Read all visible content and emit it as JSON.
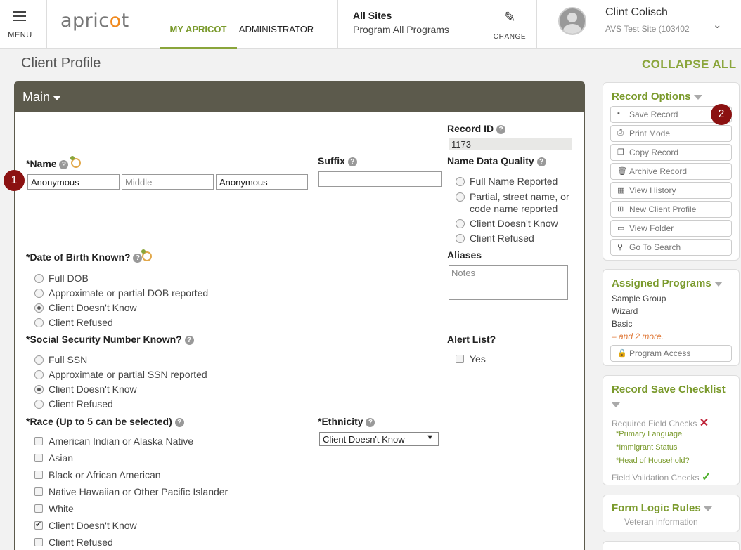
{
  "topbar": {
    "menu_label": "MENU",
    "logo_pre": "apric",
    "logo_dot": "o",
    "logo_post": "t",
    "tabs": [
      {
        "label": "MY APRICOT",
        "active": true
      },
      {
        "label": "ADMINISTRATOR",
        "active": false
      }
    ],
    "site_title": "All Sites",
    "site_program": "Program All Programs",
    "change_label": "CHANGE",
    "user_name": "Clint Colisch",
    "user_site": "AVS Test Site (103402"
  },
  "page": {
    "title": "Client Profile",
    "collapse_all": "COLLAPSE ALL"
  },
  "main": {
    "section_title": "Main",
    "record_id_label": "Record ID",
    "record_id_value": "1173",
    "name_label": "*Name",
    "name_first": "Anonymous",
    "name_middle_placeholder": "Middle",
    "name_last": "Anonymous",
    "suffix_label": "Suffix",
    "suffix_value": "",
    "name_quality_label": "Name Data Quality",
    "name_quality_options": [
      {
        "label": "Full Name Reported",
        "selected": false
      },
      {
        "label": "Partial, street name, or",
        "selected": false
      },
      {
        "label": "code name reported",
        "selected": false
      },
      {
        "label": "Client Doesn't Know",
        "selected": false
      },
      {
        "label": "Client Refused",
        "selected": false
      }
    ],
    "dob_label": "*Date of Birth Known?",
    "dob_options": [
      {
        "label": "Full DOB",
        "selected": false
      },
      {
        "label": "Approximate or partial DOB reported",
        "selected": false
      },
      {
        "label": "Client Doesn't Know",
        "selected": true
      },
      {
        "label": "Client Refused",
        "selected": false
      }
    ],
    "aliases_label": "Aliases",
    "aliases_placeholder": "Notes",
    "ssn_label": "*Social Security Number Known?",
    "ssn_options": [
      {
        "label": "Full SSN",
        "selected": false
      },
      {
        "label": "Approximate or partial SSN reported",
        "selected": false
      },
      {
        "label": "Client Doesn't Know",
        "selected": true
      },
      {
        "label": "Client Refused",
        "selected": false
      }
    ],
    "alert_label": "Alert List?",
    "alert_option": "Yes",
    "race_label": "*Race (Up to 5 can be selected)",
    "race_options": [
      {
        "label": "American Indian or Alaska Native",
        "checked": false
      },
      {
        "label": "Asian",
        "checked": false
      },
      {
        "label": "Black or African American",
        "checked": false
      },
      {
        "label": "Native Hawaiian or Other Pacific Islander",
        "checked": false
      },
      {
        "label": "White",
        "checked": false
      },
      {
        "label": "Client Doesn't Know",
        "checked": true
      },
      {
        "label": "Client Refused",
        "checked": false
      }
    ],
    "ethnicity_label": "*Ethnicity",
    "ethnicity_value": "Client Doesn't Know",
    "badge_1": "1",
    "badge_2": "2"
  },
  "record_options": {
    "title": "Record Options",
    "buttons": [
      {
        "label": "Save Record",
        "icon": "save-icon",
        "glyph": "▪"
      },
      {
        "label": "Print Mode",
        "icon": "print-icon",
        "glyph": "⎙"
      },
      {
        "label": "Copy Record",
        "icon": "copy-icon",
        "glyph": "❐"
      },
      {
        "label": "Archive Record",
        "icon": "trash-icon",
        "glyph": "🗑"
      },
      {
        "label": "View History",
        "icon": "calendar-icon",
        "glyph": "▦"
      },
      {
        "label": "New Client Profile",
        "icon": "new-document-icon",
        "glyph": "⊞"
      },
      {
        "label": "View Folder",
        "icon": "folder-icon",
        "glyph": "▭"
      },
      {
        "label": "Go To Search",
        "icon": "search-icon",
        "glyph": "⚲"
      }
    ]
  },
  "assigned_programs": {
    "title": "Assigned Programs",
    "items": [
      "Sample Group",
      "Wizard",
      "Basic"
    ],
    "more": "– and 2 more.",
    "access_button": "Program Access"
  },
  "save_checklist": {
    "title": "Record Save Checklist",
    "required_label": "Required Field Checks",
    "required_items": [
      "*Primary Language",
      "*Immigrant Status",
      "*Head of Household?"
    ],
    "validation_label": "Field Validation Checks"
  },
  "form_logic": {
    "title": "Form Logic Rules",
    "item": "Veteran Information"
  },
  "colors": {
    "accent": "#8aa53b",
    "panel_header": "#5c5a4c",
    "badge": "#8b1111"
  }
}
